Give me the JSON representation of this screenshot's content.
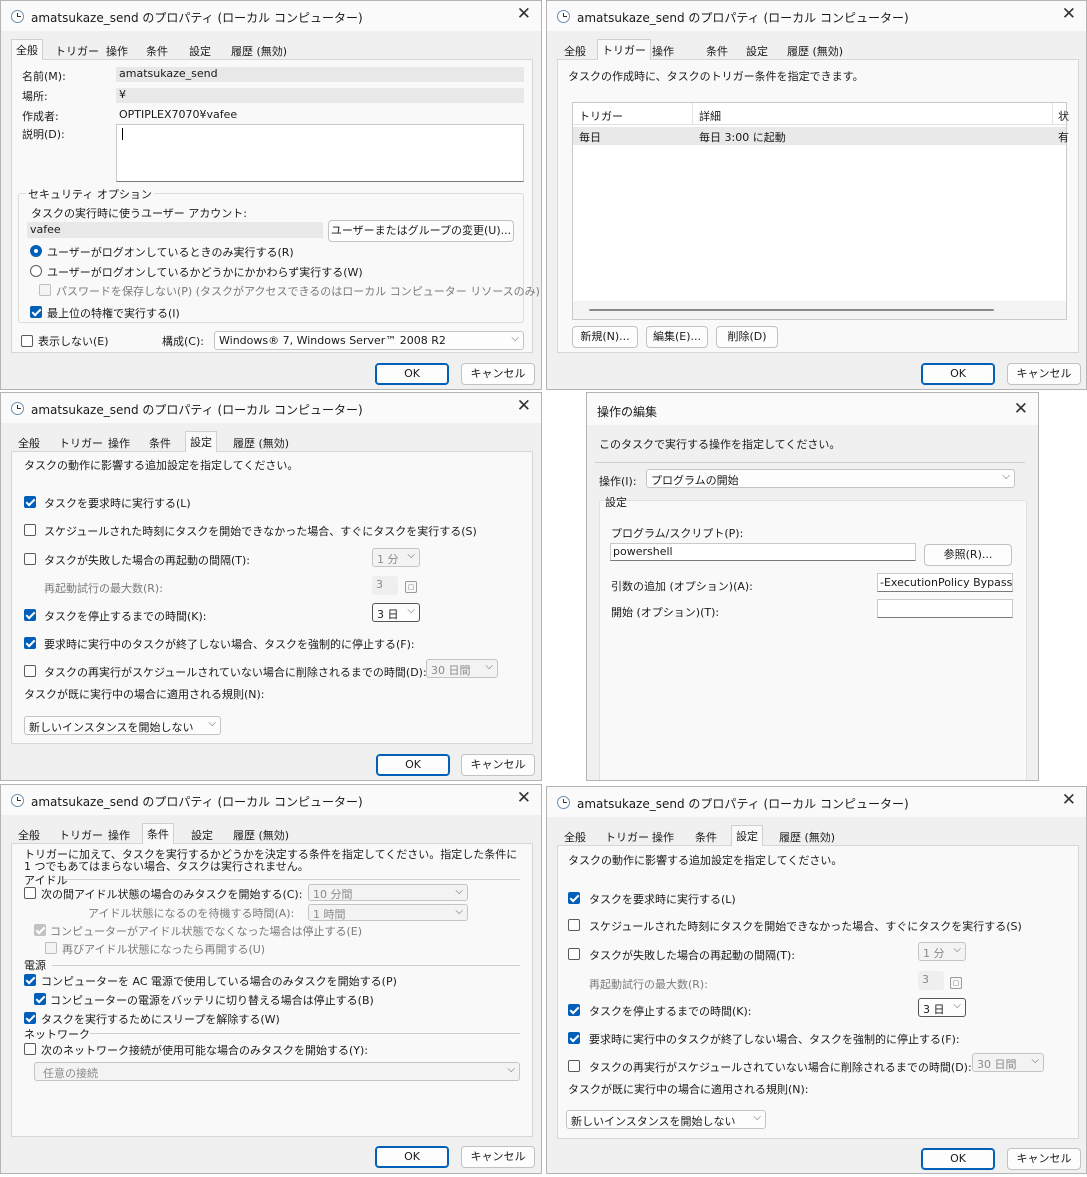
{
  "dialogs": {
    "general": {
      "title": "amatsukaze_send のプロパティ (ローカル コンピューター)",
      "tabs": [
        "全般",
        "トリガー",
        "操作",
        "条件",
        "設定",
        "履歴 (無効)"
      ],
      "name_label": "名前(M):",
      "name_value": "amatsukaze_send",
      "location_label": "場所:",
      "location_value": "¥",
      "author_label": "作成者:",
      "author_value": "OPTIPLEX7070¥vafee",
      "desc_label": "説明(D):",
      "desc_value": "",
      "security_group": "セキュリティ オプション",
      "account_label": "タスクの実行時に使うユーザー アカウント:",
      "account_value": "vafee",
      "change_user_button": "ユーザーまたはグループの変更(U)...",
      "radio_logon_only": "ユーザーがログオンしているときのみ実行する(R)",
      "radio_logon_any": "ユーザーがログオンしているかどうかにかかわらず実行する(W)",
      "no_store_password": "パスワードを保存しない(P) (タスクがアクセスできるのはローカル コンピューター リソースのみ)",
      "highest_privileges": "最上位の特権で実行する(I)",
      "hidden_label": "表示しない(E)",
      "configure_label": "構成(C):",
      "configure_value": "Windows® 7, Windows Server™ 2008 R2",
      "ok": "OK",
      "cancel": "キャンセル"
    },
    "triggers": {
      "title": "amatsukaze_send のプロパティ (ローカル コンピューター)",
      "tabs": [
        "全般",
        "トリガー",
        "操作",
        "条件",
        "設定",
        "履歴 (無効)"
      ],
      "intro": "タスクの作成時に、タスクのトリガー条件を指定できます。",
      "columns": [
        "トリガー",
        "詳細",
        "状"
      ],
      "rows": [
        [
          "毎日",
          "毎日 3:00 に起動",
          "有"
        ]
      ],
      "new_button": "新規(N)...",
      "edit_button": "編集(E)...",
      "delete_button": "削除(D)",
      "ok": "OK",
      "cancel": "キャンセル"
    },
    "settings_a": {
      "title": "amatsukaze_send のプロパティ (ローカル コンピューター)",
      "tabs": [
        "全般",
        "トリガー",
        "操作",
        "条件",
        "設定",
        "履歴 (無効)"
      ],
      "intro": "タスクの動作に影響する追加設定を指定してください。",
      "opt_on_demand": "タスクを要求時に実行する(L)",
      "opt_missed": "スケジュールされた時刻にタスクを開始できなかった場合、すぐにタスクを実行する(S)",
      "opt_restart": "タスクが失敗した場合の再起動の間隔(T):",
      "restart_value": "1 分",
      "restart_count_label": "再起動試行の最大数(R):",
      "restart_count_value": "3",
      "opt_stop_after": "タスクを停止するまでの時間(K):",
      "stop_after_value": "3 日",
      "opt_force_stop": "要求時に実行中のタスクが終了しない場合、タスクを強制的に停止する(F):",
      "opt_delete": "タスクの再実行がスケジュールされていない場合に削除されるまでの時間(D):",
      "delete_value": "30 日間",
      "rule_label": "タスクが既に実行中の場合に適用される規則(N):",
      "rule_value": "新しいインスタンスを開始しない",
      "ok": "OK",
      "cancel": "キャンセル"
    },
    "action_edit": {
      "title": "操作の編集",
      "intro": "このタスクで実行する操作を指定してください。",
      "action_label": "操作(I):",
      "action_value": "プログラムの開始",
      "settings_group": "設定",
      "program_label": "プログラム/スクリプト(P):",
      "program_value": "powershell",
      "browse_button": "参照(R)...",
      "args_label": "引数の追加 (オプション)(A):",
      "args_value": "-ExecutionPolicy Bypass",
      "start_in_label": "開始 (オプション)(T):",
      "start_in_value": ""
    },
    "conditions": {
      "title": "amatsukaze_send のプロパティ (ローカル コンピューター)",
      "tabs": [
        "全般",
        "トリガー",
        "操作",
        "条件",
        "設定",
        "履歴 (無効)"
      ],
      "intro": "トリガーに加えて、タスクを実行するかどうかを決定する条件を指定してください。指定した条件に 1 つでもあてはまらない場合、タスクは実行されません。",
      "idle_group": "アイドル",
      "idle_start": "次の間アイドル状態の場合のみタスクを開始する(C):",
      "idle_start_value": "10 分間",
      "idle_wait_label": "アイドル状態になるのを待機する時間(A):",
      "idle_wait_value": "1 時間",
      "idle_stop": "コンピューターがアイドル状態でなくなった場合は停止する(E)",
      "idle_restart": "再びアイドル状態になったら再開する(U)",
      "power_group": "電源",
      "power_ac": "コンピューターを AC 電源で使用している場合のみタスクを開始する(P)",
      "power_battery": "コンピューターの電源をバッテリに切り替える場合は停止する(B)",
      "power_wake": "タスクを実行するためにスリープを解除する(W)",
      "network_group": "ネットワーク",
      "network_start": "次のネットワーク接続が使用可能な場合のみタスクを開始する(Y):",
      "network_value": "任意の接続",
      "ok": "OK",
      "cancel": "キャンセル"
    },
    "settings_b": {
      "title": "amatsukaze_send のプロパティ (ローカル コンピューター)",
      "tabs": [
        "全般",
        "トリガー",
        "操作",
        "条件",
        "設定",
        "履歴 (無効)"
      ],
      "intro": "タスクの動作に影響する追加設定を指定してください。",
      "opt_on_demand": "タスクを要求時に実行する(L)",
      "opt_missed": "スケジュールされた時刻にタスクを開始できなかった場合、すぐにタスクを実行する(S)",
      "opt_restart": "タスクが失敗した場合の再起動の間隔(T):",
      "restart_value": "1 分",
      "restart_count_label": "再起動試行の最大数(R):",
      "restart_count_value": "3",
      "opt_stop_after": "タスクを停止するまでの時間(K):",
      "stop_after_value": "3 日",
      "opt_force_stop": "要求時に実行中のタスクが終了しない場合、タスクを強制的に停止する(F):",
      "opt_delete": "タスクの再実行がスケジュールされていない場合に削除されるまでの時間(D):",
      "delete_value": "30 日間",
      "rule_label": "タスクが既に実行中の場合に適用される規則(N):",
      "rule_value": "新しいインスタンスを開始しない",
      "ok": "OK",
      "cancel": "キャンセル"
    }
  }
}
